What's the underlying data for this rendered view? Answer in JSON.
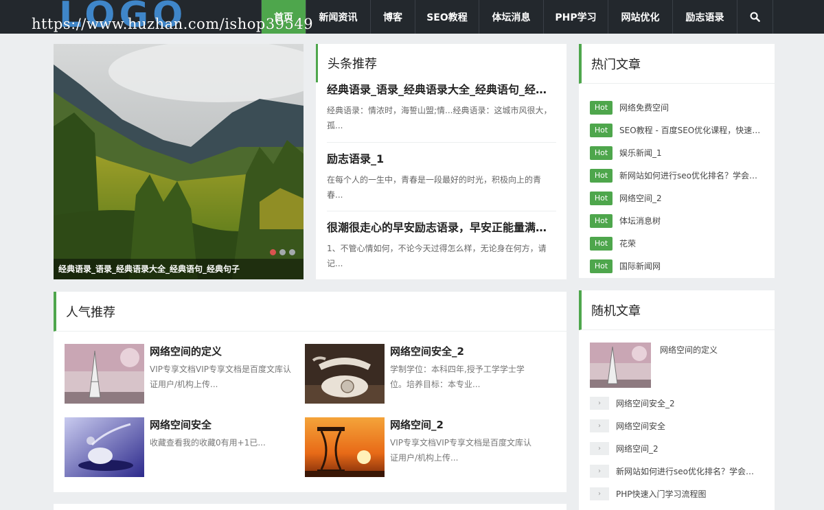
{
  "header": {
    "logo": "LOGO",
    "watermark": "https://www.huzhan.com/ishop39549",
    "nav": [
      {
        "label": "首页",
        "active": true
      },
      {
        "label": "新闻资讯",
        "active": false
      },
      {
        "label": "博客",
        "active": false
      },
      {
        "label": "SEO教程",
        "active": false
      },
      {
        "label": "体坛消息",
        "active": false
      },
      {
        "label": "PHP学习",
        "active": false
      },
      {
        "label": "网站优化",
        "active": false
      },
      {
        "label": "励志语录",
        "active": false
      }
    ],
    "search_icon": "search-icon"
  },
  "slider": {
    "caption": "经典语录_语录_经典语录大全_经典语句_经典句子",
    "dots": 3,
    "active_dot": 1
  },
  "headlines": {
    "title": "头条推荐",
    "items": [
      {
        "title": "经典语录_语录_经典语录大全_经典语句_经典句子",
        "desc": "经典语录：情浓时，海誓山盟;情...经典语录：这城市风很大，孤..."
      },
      {
        "title": "励志语录_1",
        "desc": "在每个人的一生中，青春是一段最好的时光，积极向上的青春..."
      },
      {
        "title": "很潮很走心的早安励志语录，早安正能量满满的句子",
        "desc": "1、不管心情如何，不论今天过得怎么样，无论身在何方，请记..."
      }
    ]
  },
  "hot": {
    "title": "热门文章",
    "badge": "Hot",
    "items": [
      "网络免费空间",
      "SEO教程 - 百度SEO优化课程，快速排名",
      "娱乐新闻_1",
      "新网站如何进行seo优化排名？学会这几招",
      "网络空间_2",
      "体坛消息树",
      "花荣",
      "国际新闻网"
    ]
  },
  "popular": {
    "title": "人气推荐",
    "items": [
      {
        "title": "网络空间的定义",
        "desc": "VIP专享文档VIP专享文档是百度文库认证用户/机构上传..."
      },
      {
        "title": "网络空间安全_2",
        "desc": "学制学位：本科四年,授予工学学士学位。培养目标：本专业..."
      },
      {
        "title": "网络空间安全",
        "desc": "收藏查看我的收藏0有用+1已..."
      },
      {
        "title": "网络空间_2",
        "desc": "VIP专享文档VIP专享文档是百度文库认证用户/机构上传..."
      }
    ]
  },
  "random": {
    "title": "随机文章",
    "top_title": "网络空间的定义",
    "arrow": "›",
    "items": [
      "网络空间安全_2",
      "网络空间安全",
      "网络空间_2",
      "新网站如何进行seo优化排名？学会这几招",
      "PHP快速入门学习流程图"
    ]
  },
  "colors": {
    "accent": "#4ea64c",
    "topbar": "#23282d",
    "background": "#eceef0",
    "logo": "#3f86c9"
  }
}
